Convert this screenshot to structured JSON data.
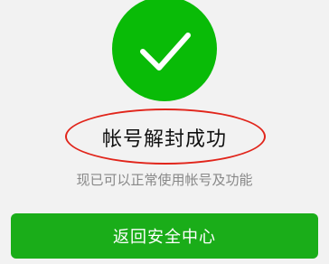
{
  "status": {
    "icon": "checkmark-icon",
    "color": "#09bb07"
  },
  "message": {
    "title": "帐号解封成功",
    "subtitle": "现已可以正常使用帐号及功能"
  },
  "annotation": {
    "color": "#e1251b"
  },
  "actions": {
    "primary_label": "返回安全中心",
    "primary_color": "#1aad19"
  }
}
